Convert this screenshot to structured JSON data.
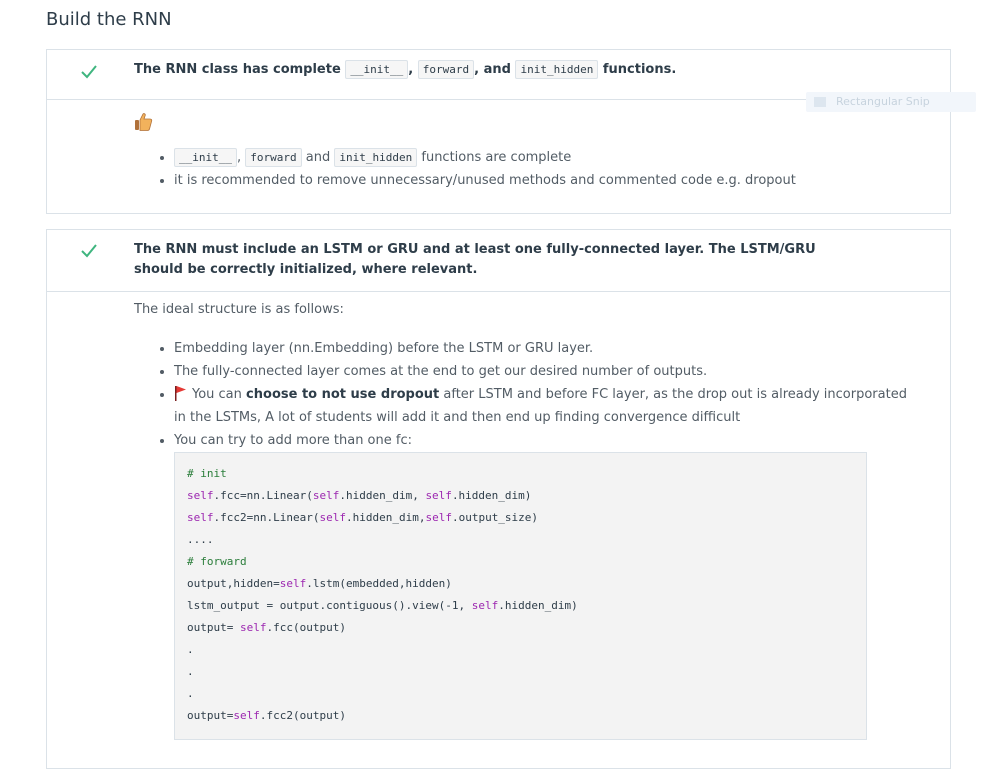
{
  "section": {
    "title": "Build the RNN"
  },
  "colors": {
    "check": "#02b3e4",
    "accent": "#2e3d49",
    "flag": "#e53935"
  },
  "criteria": [
    {
      "status": "met",
      "head": {
        "prefix": "The RNN class has complete",
        "code1": "__init__",
        "sep1": ",",
        "code2": "forward",
        "sep2": ", and",
        "code3": "init_hidden",
        "suffix": "functions."
      },
      "reviewer_icon": "thumbs-up-icon",
      "bullets": [
        {
          "code1": "__init__",
          "sep1": ",",
          "code2": "forward",
          "sep2": "and",
          "code3": "init_hidden",
          "suffix": "functions are complete"
        },
        {
          "text": "it is recommended to remove unnecessary/unused methods and commented code e.g. dropout"
        }
      ]
    },
    {
      "status": "met",
      "head_text": "The RNN must include an LSTM or GRU and at least one fully-connected layer. The LSTM/GRU should be correctly initialized, where relevant.",
      "intro": "The ideal structure is as follows:",
      "bullets": [
        {
          "text": "Embedding layer (nn.Embedding) before the LSTM or GRU layer."
        },
        {
          "text": "The fully-connected layer comes at the end to get our desired number of outputs."
        },
        {
          "pre": "You can",
          "bold": "choose to not use dropout",
          "post": "after LSTM and before FC layer, as the drop out is already incorporated in the LSTMs, A lot of students will add it and then end up finding convergence difficult"
        },
        {
          "text": "You can try to add more than one fc:"
        }
      ],
      "code_lines": [
        "# init",
        "self.fcc=nn.Linear(self.hidden_dim, self.hidden_dim)",
        "self.fcc2=nn.Linear(self.hidden_dim,self.output_size)",
        "....",
        "# forward",
        "output,hidden=self.lstm(embedded,hidden)",
        "lstm_output = output.contiguous().view(-1, self.hidden_dim)",
        "output= self.fcc(output)",
        ".",
        ".",
        ".",
        "output=self.fcc2(output)"
      ]
    }
  ],
  "overlay": {
    "label": "Rectangular Snip"
  }
}
